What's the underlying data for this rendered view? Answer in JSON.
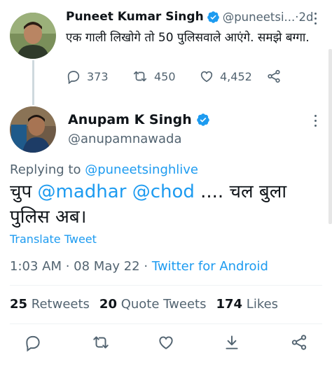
{
  "parent_tweet": {
    "author_name": "Puneet Kumar Singh",
    "author_handle": "@puneetsi...",
    "separator": " · ",
    "time": "2d",
    "text": "एक गाली लिखोगे तो 50 पुलिसवाले आएंगे. समझे बग्गा.",
    "replies": "373",
    "retweets": "450",
    "likes": "4,452"
  },
  "main_tweet": {
    "author_name": "Anupam K Singh",
    "author_handle": "@anupamnawada",
    "replying_prefix": "Replying to ",
    "replying_handle": "@puneetsinghlive",
    "text_part1": "चुप ",
    "mention1": "@madhar",
    "space": " ",
    "mention2": "@chod",
    "text_part2": " .... चल बुला पुलिस अब।",
    "translate_label": "Translate Tweet",
    "time": "1:03 AM",
    "date_sep": " · ",
    "date": "08 May 22",
    "source_sep": " · ",
    "source": "Twitter for Android"
  },
  "stats": {
    "retweets_count": "25",
    "retweets_label": " Retweets",
    "quotes_count": "20",
    "quotes_label": " Quote Tweets",
    "likes_count": "174",
    "likes_label": " Likes"
  },
  "colors": {
    "accent": "#1d9bf0",
    "secondary_text": "#536471",
    "primary_text": "#0f1419",
    "divider": "#eff3f4"
  },
  "icons": {
    "verified": "verified-badge-icon",
    "reply": "reply-icon",
    "retweet": "retweet-icon",
    "like": "heart-icon",
    "share": "share-icon",
    "bookmark": "download-icon",
    "more": "more-vertical-icon"
  }
}
